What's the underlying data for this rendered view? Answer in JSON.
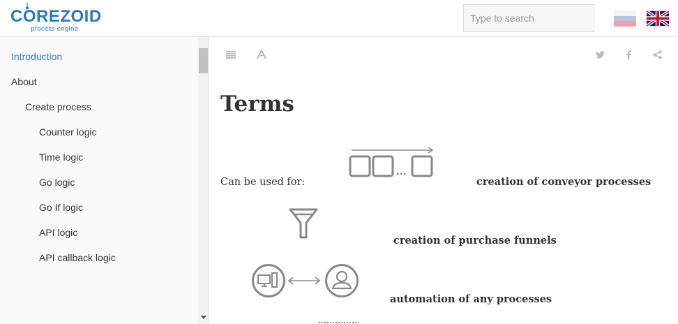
{
  "header": {
    "logo_text": "COREZOID",
    "logo_subtitle": "process engine",
    "search_placeholder": "Type to search",
    "languages": [
      "ru",
      "en"
    ]
  },
  "sidebar": {
    "items": [
      {
        "label": "Introduction",
        "active": true
      },
      {
        "label": "About"
      },
      {
        "label": "Create process"
      },
      {
        "label": "Counter logic"
      },
      {
        "label": "Time logic"
      },
      {
        "label": "Go logic"
      },
      {
        "label": "Go If logic"
      },
      {
        "label": "API logic"
      },
      {
        "label": "API callback logic"
      }
    ]
  },
  "toolbar": {
    "icons": [
      "menu-icon",
      "font-icon",
      "twitter-icon",
      "facebook-icon",
      "share-icon"
    ]
  },
  "content": {
    "title": "Terms",
    "used_for": "Can be used for:",
    "terms": [
      "creation of conveyor processes",
      "creation of purchase funnels",
      "automation of any processes"
    ]
  },
  "colors": {
    "brand": "#2b78c2",
    "active_link": "#2f7fce",
    "icon_gray": "#bbbbbb",
    "illustration_gray": "#888888"
  }
}
